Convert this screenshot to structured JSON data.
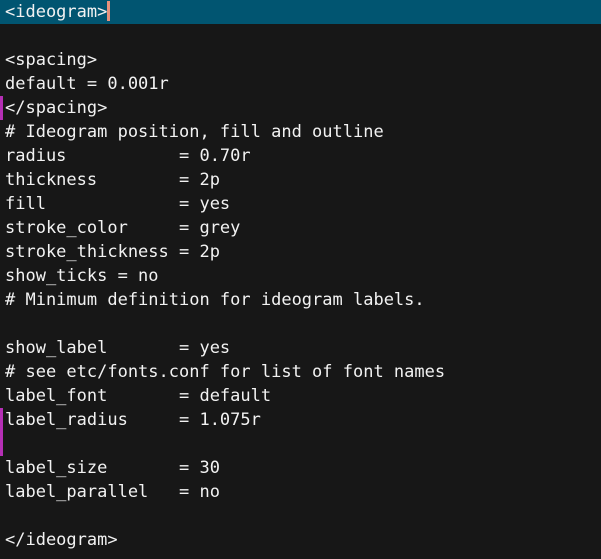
{
  "editor": {
    "background_color": "#171717",
    "foreground_color": "#f2f2f2",
    "current_line_highlight_color": "#015571",
    "caret_color": "#e8927c",
    "change_marker_color": "#b52fb5"
  },
  "document": {
    "lines": [
      {
        "text": "<ideogram>",
        "highlighted": true,
        "caret": true,
        "changed": false
      },
      {
        "text": "",
        "highlighted": false,
        "caret": false,
        "changed": false
      },
      {
        "text": "<spacing>",
        "highlighted": false,
        "caret": false,
        "changed": false
      },
      {
        "text": "default = 0.001r",
        "highlighted": false,
        "caret": false,
        "changed": false
      },
      {
        "text": "</spacing>",
        "highlighted": false,
        "caret": false,
        "changed": true
      },
      {
        "text": "# Ideogram position, fill and outline",
        "highlighted": false,
        "caret": false,
        "changed": false
      },
      {
        "text": "radius           = 0.70r",
        "highlighted": false,
        "caret": false,
        "changed": false
      },
      {
        "text": "thickness        = 2p",
        "highlighted": false,
        "caret": false,
        "changed": false
      },
      {
        "text": "fill             = yes",
        "highlighted": false,
        "caret": false,
        "changed": false
      },
      {
        "text": "stroke_color     = grey",
        "highlighted": false,
        "caret": false,
        "changed": false
      },
      {
        "text": "stroke_thickness = 2p",
        "highlighted": false,
        "caret": false,
        "changed": false
      },
      {
        "text": "show_ticks = no",
        "highlighted": false,
        "caret": false,
        "changed": false
      },
      {
        "text": "# Minimum definition for ideogram labels.",
        "highlighted": false,
        "caret": false,
        "changed": false
      },
      {
        "text": "",
        "highlighted": false,
        "caret": false,
        "changed": false
      },
      {
        "text": "show_label       = yes",
        "highlighted": false,
        "caret": false,
        "changed": false
      },
      {
        "text": "# see etc/fonts.conf for list of font names",
        "highlighted": false,
        "caret": false,
        "changed": false
      },
      {
        "text": "label_font       = default",
        "highlighted": false,
        "caret": false,
        "changed": false
      },
      {
        "text": "label_radius     = 1.075r",
        "highlighted": false,
        "caret": false,
        "changed": true
      },
      {
        "text": "",
        "highlighted": false,
        "caret": false,
        "changed": true
      },
      {
        "text": "label_size       = 30",
        "highlighted": false,
        "caret": false,
        "changed": false
      },
      {
        "text": "label_parallel   = no",
        "highlighted": false,
        "caret": false,
        "changed": false
      },
      {
        "text": "",
        "highlighted": false,
        "caret": false,
        "changed": false
      },
      {
        "text": "</ideogram>",
        "highlighted": false,
        "caret": false,
        "changed": false
      }
    ]
  }
}
